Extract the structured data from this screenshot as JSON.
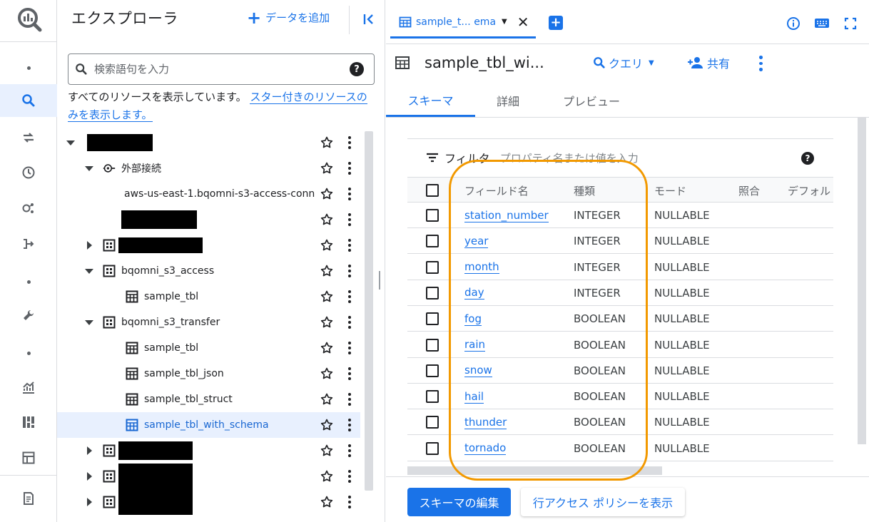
{
  "app": {
    "icon": "bigquery-logo-icon"
  },
  "rail": {
    "items": [
      {
        "icon": "dot-icon"
      },
      {
        "icon": "search-icon",
        "active": true
      },
      {
        "icon": "transfer-arrows-icon"
      },
      {
        "icon": "clock-icon"
      },
      {
        "icon": "analytics-hub-icon"
      },
      {
        "icon": "dataflow-icon"
      },
      {
        "icon": "dot-icon"
      },
      {
        "icon": "wrench-icon"
      },
      {
        "icon": "dot-icon"
      },
      {
        "icon": "monitoring-chart-icon"
      },
      {
        "icon": "dashboard-icon"
      },
      {
        "icon": "table-view-icon"
      },
      {
        "icon": "release-notes-icon"
      }
    ]
  },
  "explorer": {
    "title": "エクスプローラ",
    "add_data_label": "データを追加",
    "search_placeholder": "検索語句を入力",
    "showing_text": "すべてのリソースを表示しています。",
    "starred_link": "スター付きのリソースのみを表示します。",
    "tree": [
      {
        "label": "",
        "redacted": true,
        "icon": "",
        "arrow": "down"
      },
      {
        "label": "外部接続",
        "icon": "connection-icon",
        "arrow": "down"
      },
      {
        "label": "aws-us-east-1.bqomni-s3-access-conn",
        "icon": "",
        "arrow": ""
      },
      {
        "label": "",
        "redacted": true,
        "icon": "",
        "arrow": ""
      },
      {
        "label": "",
        "redacted": true,
        "icon": "dataset-icon",
        "arrow": "right"
      },
      {
        "label": "bqomni_s3_access",
        "icon": "dataset-icon",
        "arrow": "down"
      },
      {
        "label": "sample_tbl",
        "icon": "table-icon",
        "arrow": ""
      },
      {
        "label": "bqomni_s3_transfer",
        "icon": "dataset-icon",
        "arrow": "down"
      },
      {
        "label": "sample_tbl",
        "icon": "table-icon",
        "arrow": ""
      },
      {
        "label": "sample_tbl_json",
        "icon": "table-icon",
        "arrow": ""
      },
      {
        "label": "sample_tbl_struct",
        "icon": "table-icon",
        "arrow": ""
      },
      {
        "label": "sample_tbl_with_schema",
        "icon": "table-icon",
        "arrow": "",
        "selected": true
      },
      {
        "label": "",
        "redacted": true,
        "icon": "dataset-icon",
        "arrow": "right"
      },
      {
        "label": "",
        "redacted": true,
        "icon": "dataset-icon",
        "arrow": "right"
      },
      {
        "label": "",
        "redacted": true,
        "icon": "dataset-icon",
        "arrow": "right"
      }
    ]
  },
  "tabs": {
    "active_label": "sample_t... ema"
  },
  "resource": {
    "title": "sample_tbl_wi...",
    "query_label": "クエリ",
    "share_label": "共有"
  },
  "subtabs": [
    "スキーマ",
    "詳細",
    "プレビュー"
  ],
  "schema": {
    "filter_label": "フィルタ",
    "filter_placeholder": "プロパティ名または値を入力",
    "columns": [
      "フィールド名",
      "種類",
      "モード",
      "照合",
      "デフォル"
    ],
    "rows": [
      {
        "name": "station_number",
        "type": "INTEGER",
        "mode": "NULLABLE"
      },
      {
        "name": "year",
        "type": "INTEGER",
        "mode": "NULLABLE"
      },
      {
        "name": "month",
        "type": "INTEGER",
        "mode": "NULLABLE"
      },
      {
        "name": "day",
        "type": "INTEGER",
        "mode": "NULLABLE"
      },
      {
        "name": "fog",
        "type": "BOOLEAN",
        "mode": "NULLABLE"
      },
      {
        "name": "rain",
        "type": "BOOLEAN",
        "mode": "NULLABLE"
      },
      {
        "name": "snow",
        "type": "BOOLEAN",
        "mode": "NULLABLE"
      },
      {
        "name": "hail",
        "type": "BOOLEAN",
        "mode": "NULLABLE"
      },
      {
        "name": "thunder",
        "type": "BOOLEAN",
        "mode": "NULLABLE"
      },
      {
        "name": "tornado",
        "type": "BOOLEAN",
        "mode": "NULLABLE"
      }
    ]
  },
  "footer": {
    "edit_schema_label": "スキーマの編集",
    "row_access_label": "行アクセス ポリシーを表示"
  },
  "colors": {
    "accent": "#1a73e8",
    "highlight": "#f29900"
  }
}
